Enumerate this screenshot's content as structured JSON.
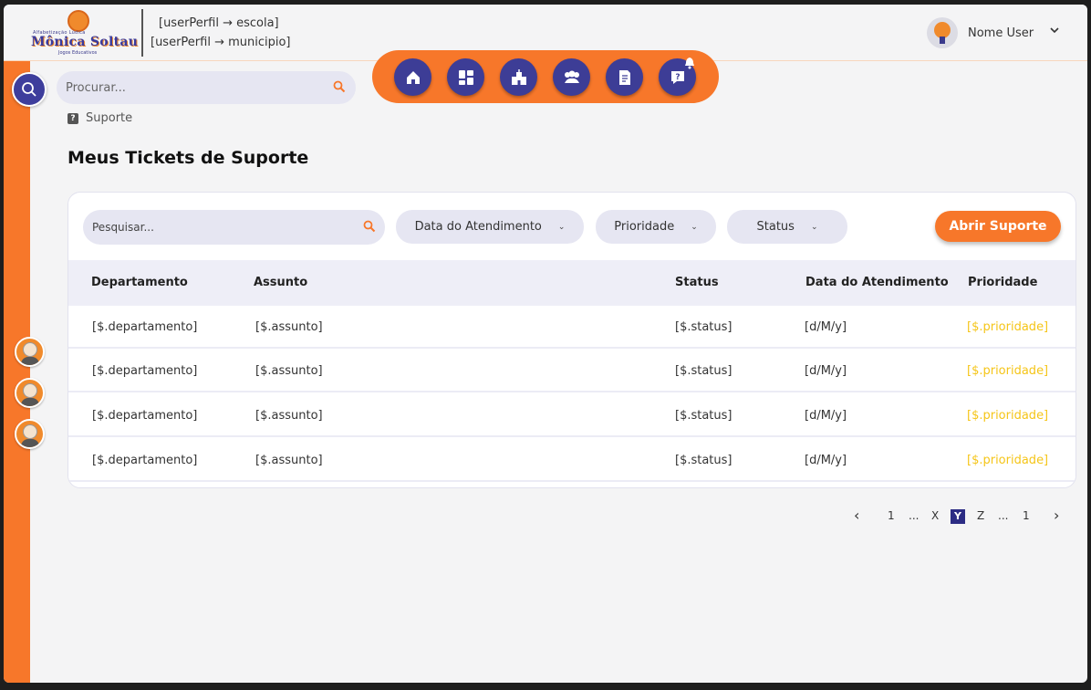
{
  "header": {
    "logo": {
      "tiny_top": "Alfabetização  Lúdica",
      "brand": "Mônica Soltau",
      "tiny_bottom": "Jogos Educativos"
    },
    "perfil_line1": "[userPerfil → escola]",
    "perfil_line2": "[userPerfil → municipio]",
    "user_name": "Nome User",
    "user_menu_chevron": "⌄"
  },
  "search": {
    "placeholder": "Procurar..."
  },
  "nav": {
    "items": [
      "home-icon",
      "dashboard-icon",
      "school-icon",
      "users-icon",
      "document-icon",
      "help-icon"
    ],
    "notification_icon": "bell-icon"
  },
  "breadcrumb": {
    "label": "Suporte",
    "icon": "question-icon"
  },
  "page_title": "Meus Tickets de Suporte",
  "filters": {
    "search_placeholder": "Pesquisar...",
    "data_atendimento": "Data do Atendimento",
    "prioridade": "Prioridade",
    "status": "Status",
    "open_button": "Abrir Suporte"
  },
  "table": {
    "headers": [
      "Departamento",
      "Assunto",
      "Status",
      "Data do Atendimento",
      "Prioridade"
    ],
    "rows": [
      [
        "[$.departamento]",
        "[$.assunto]",
        "[$.status]",
        "[d/M/y]",
        "[$.prioridade]"
      ],
      [
        "[$.departamento]",
        "[$.assunto]",
        "[$.status]",
        "[d/M/y]",
        "[$.prioridade]"
      ],
      [
        "[$.departamento]",
        "[$.assunto]",
        "[$.status]",
        "[d/M/y]",
        "[$.prioridade]"
      ],
      [
        "[$.departamento]",
        "[$.assunto]",
        "[$.status]",
        "[d/M/y]",
        "[$.prioridade]"
      ]
    ]
  },
  "pagination": {
    "prev": "‹",
    "items": [
      "1",
      "...",
      "X",
      "Y",
      "Z",
      "...",
      "1"
    ],
    "active": "Y",
    "next": "›"
  },
  "colors": {
    "accent": "#f7772a",
    "brand_dark": "#3d3d96",
    "priority": "#f5c518"
  }
}
